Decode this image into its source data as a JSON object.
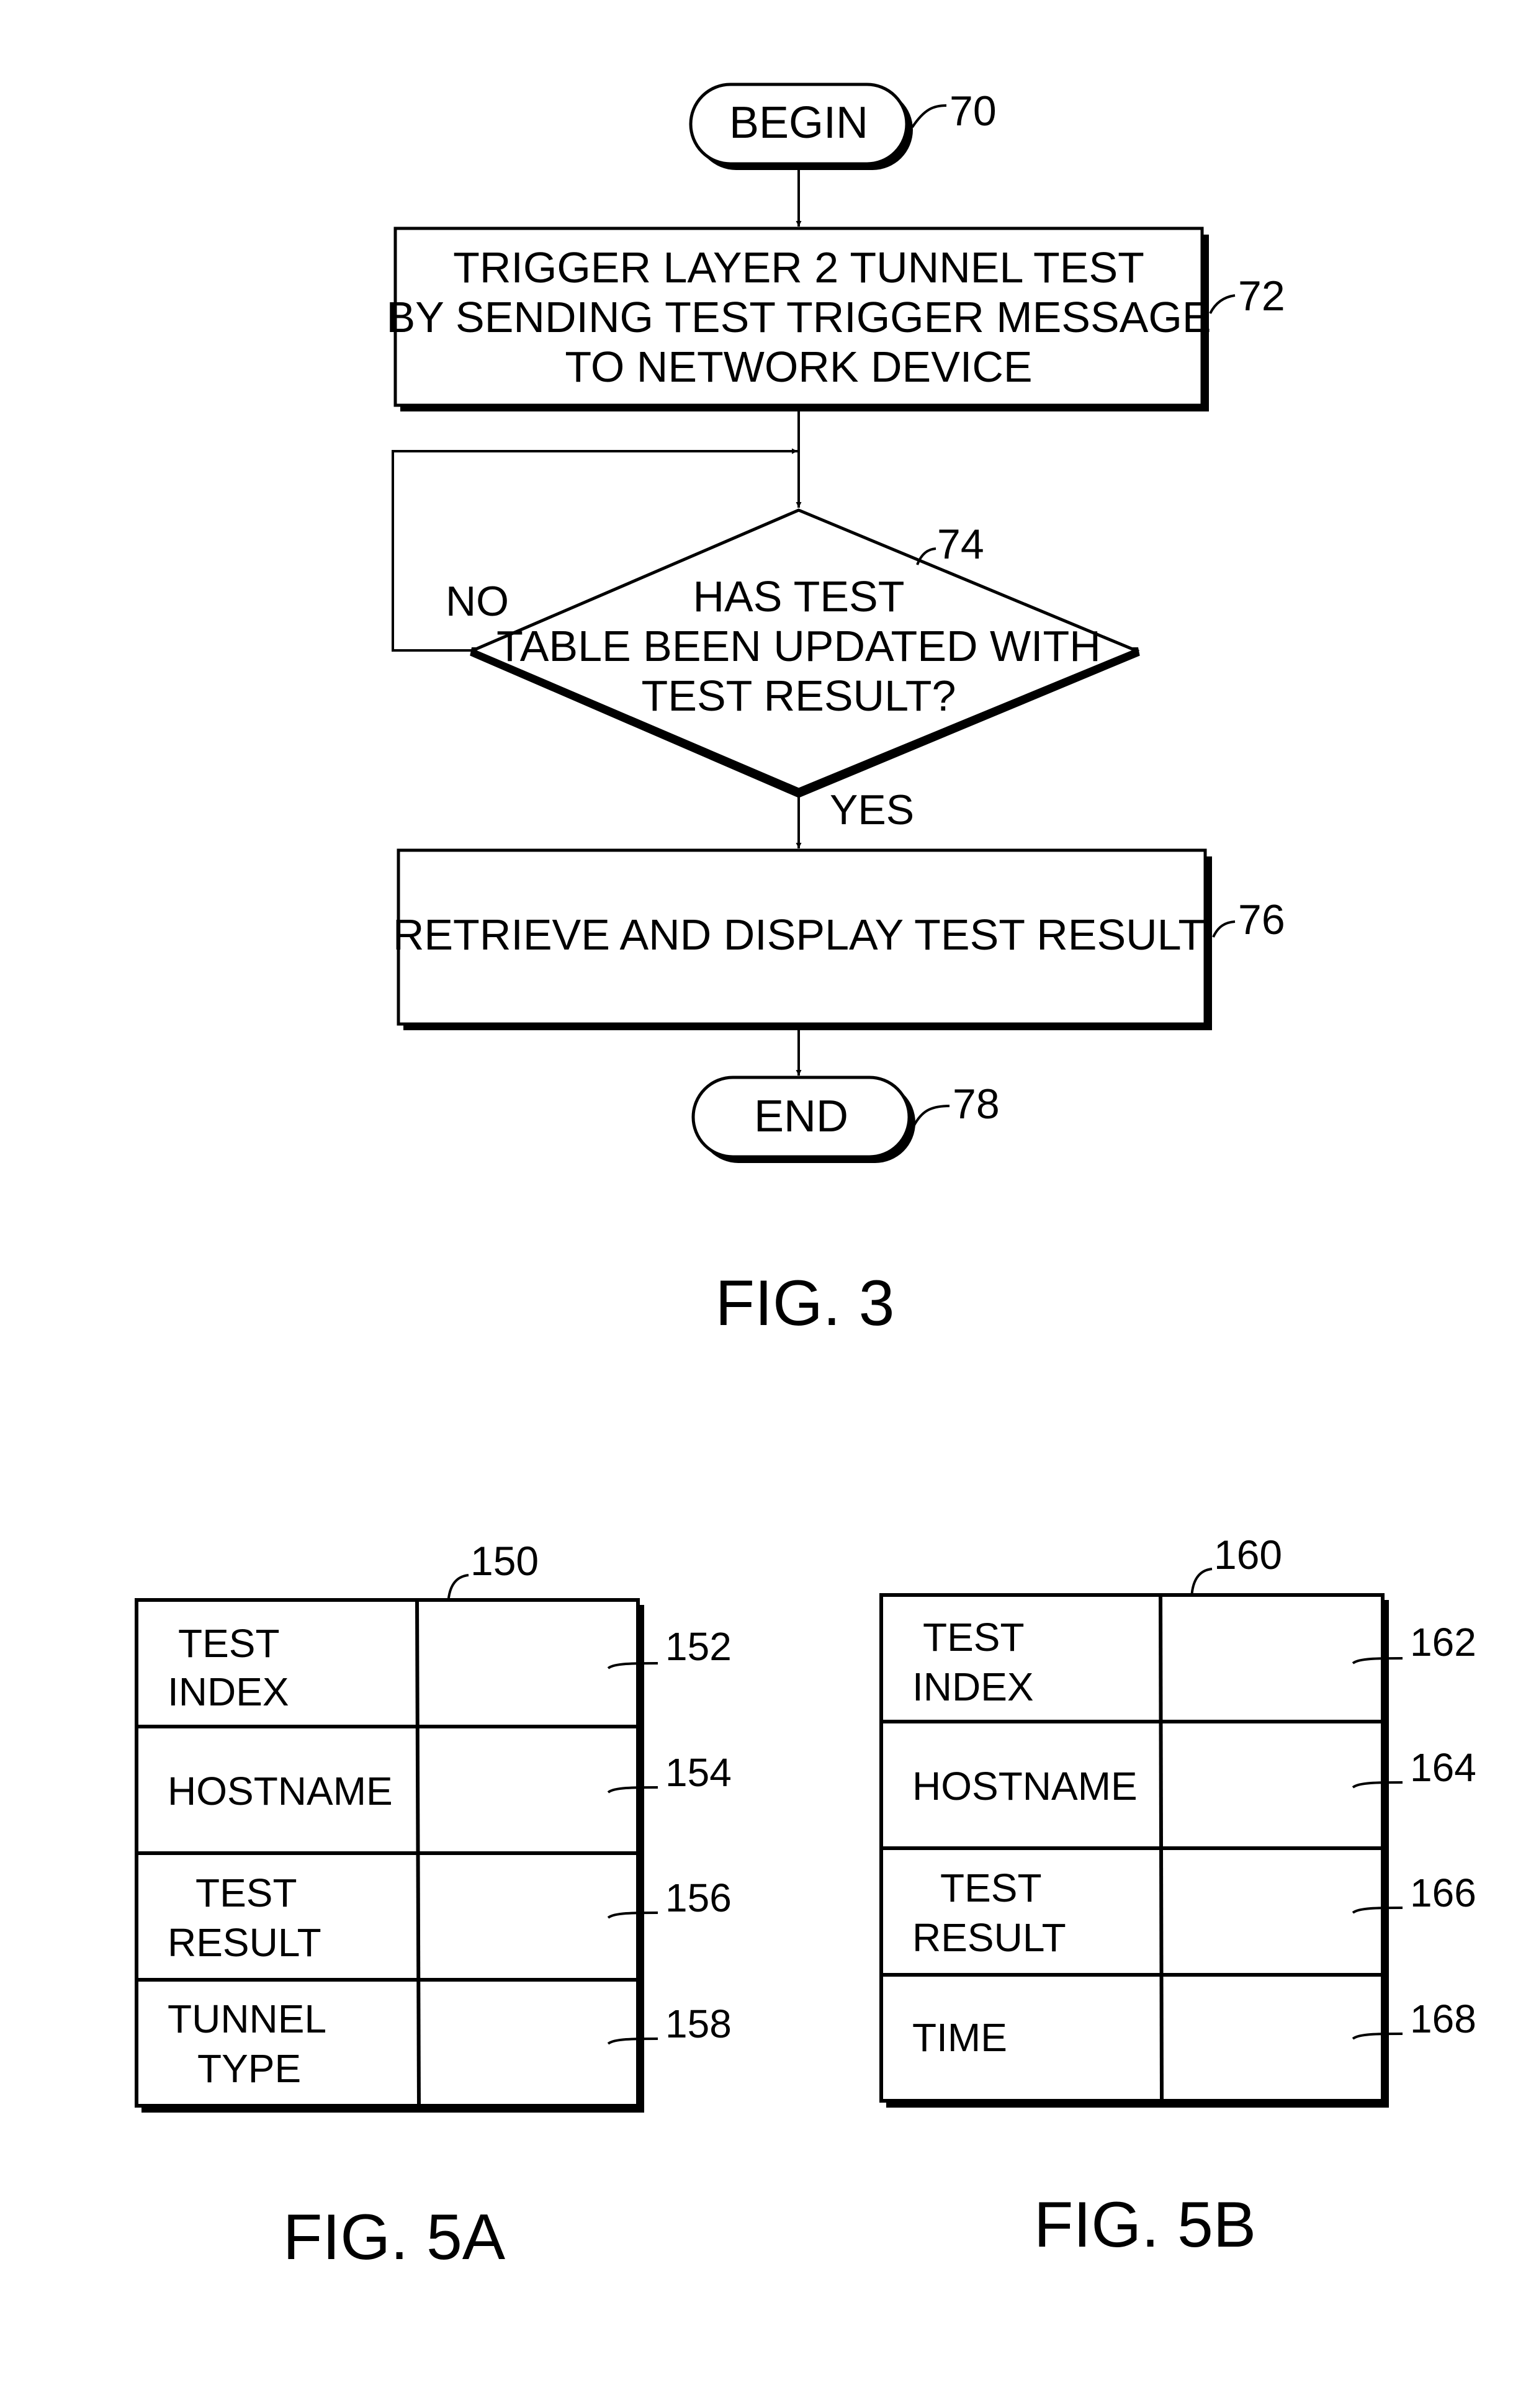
{
  "figures": {
    "fig3": {
      "caption": "FIG. 3",
      "nodes": {
        "begin": {
          "label": "BEGIN",
          "ref": "70"
        },
        "trigger": {
          "lines": [
            "TRIGGER LAYER 2 TUNNEL TEST",
            "BY SENDING TEST TRIGGER MESSAGE",
            "TO NETWORK DEVICE"
          ],
          "ref": "72"
        },
        "decision": {
          "lines": [
            "HAS TEST",
            "TABLE BEEN UPDATED WITH",
            "TEST RESULT?"
          ],
          "ref": "74"
        },
        "retrieve": {
          "label": "RETRIEVE AND DISPLAY TEST RESULT",
          "ref": "76"
        },
        "end": {
          "label": "END",
          "ref": "78"
        }
      },
      "edges": {
        "no_label": "NO",
        "yes_label": "YES"
      }
    },
    "fig5a": {
      "caption": "FIG. 5A",
      "table_ref": "150",
      "rows": [
        {
          "lines": [
            "TEST",
            "INDEX"
          ],
          "ref": "152"
        },
        {
          "lines": [
            "HOSTNAME"
          ],
          "ref": "154"
        },
        {
          "lines": [
            "TEST",
            "RESULT"
          ],
          "ref": "156"
        },
        {
          "lines": [
            "TUNNEL",
            "TYPE"
          ],
          "ref": "158"
        }
      ]
    },
    "fig5b": {
      "caption": "FIG. 5B",
      "table_ref": "160",
      "rows": [
        {
          "lines": [
            "TEST",
            "INDEX"
          ],
          "ref": "162"
        },
        {
          "lines": [
            "HOSTNAME"
          ],
          "ref": "164"
        },
        {
          "lines": [
            "TEST",
            "RESULT"
          ],
          "ref": "166"
        },
        {
          "lines": [
            "TIME"
          ],
          "ref": "168"
        }
      ]
    }
  }
}
